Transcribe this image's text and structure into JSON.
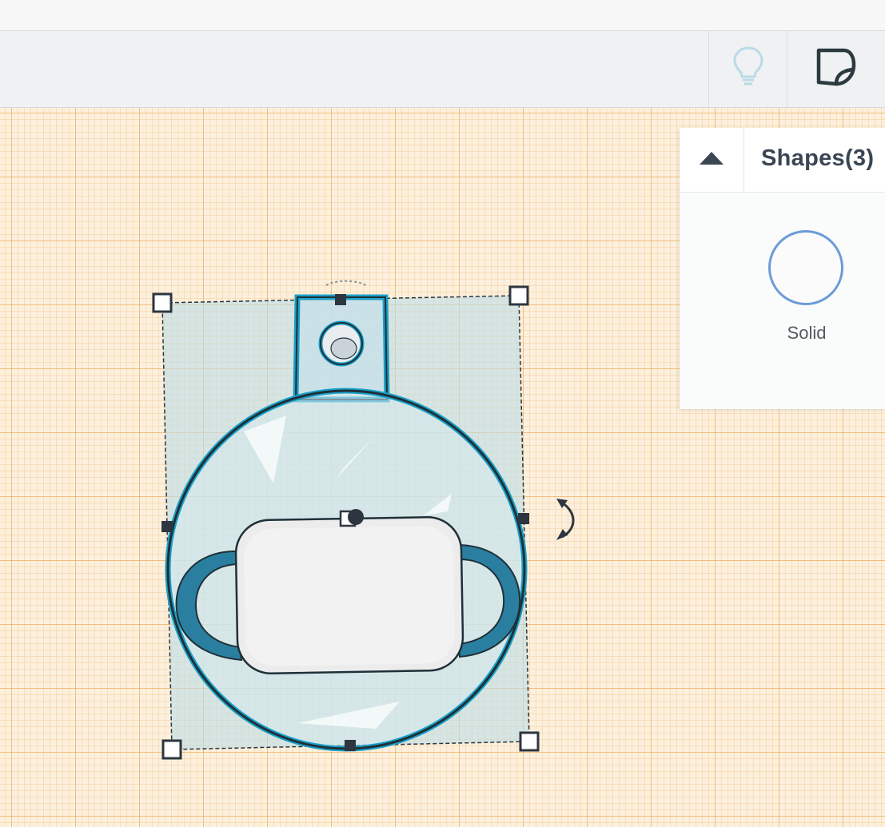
{
  "toolbar": {
    "hint_icon": "lightbulb-icon",
    "notes_icon": "note-icon"
  },
  "inspector": {
    "title": "Shapes(3)",
    "collapse_icon": "caret-up-icon",
    "mode_label": "Solid"
  },
  "canvas": {
    "grid_color": "#eca44a",
    "background_color": "#fcf0dd",
    "selection_color": "#1aa0c8",
    "shapes": [
      "ornament-body",
      "hanging-tab",
      "face-mask"
    ],
    "rotate_handle_icon": "rotate-arrows-icon"
  }
}
